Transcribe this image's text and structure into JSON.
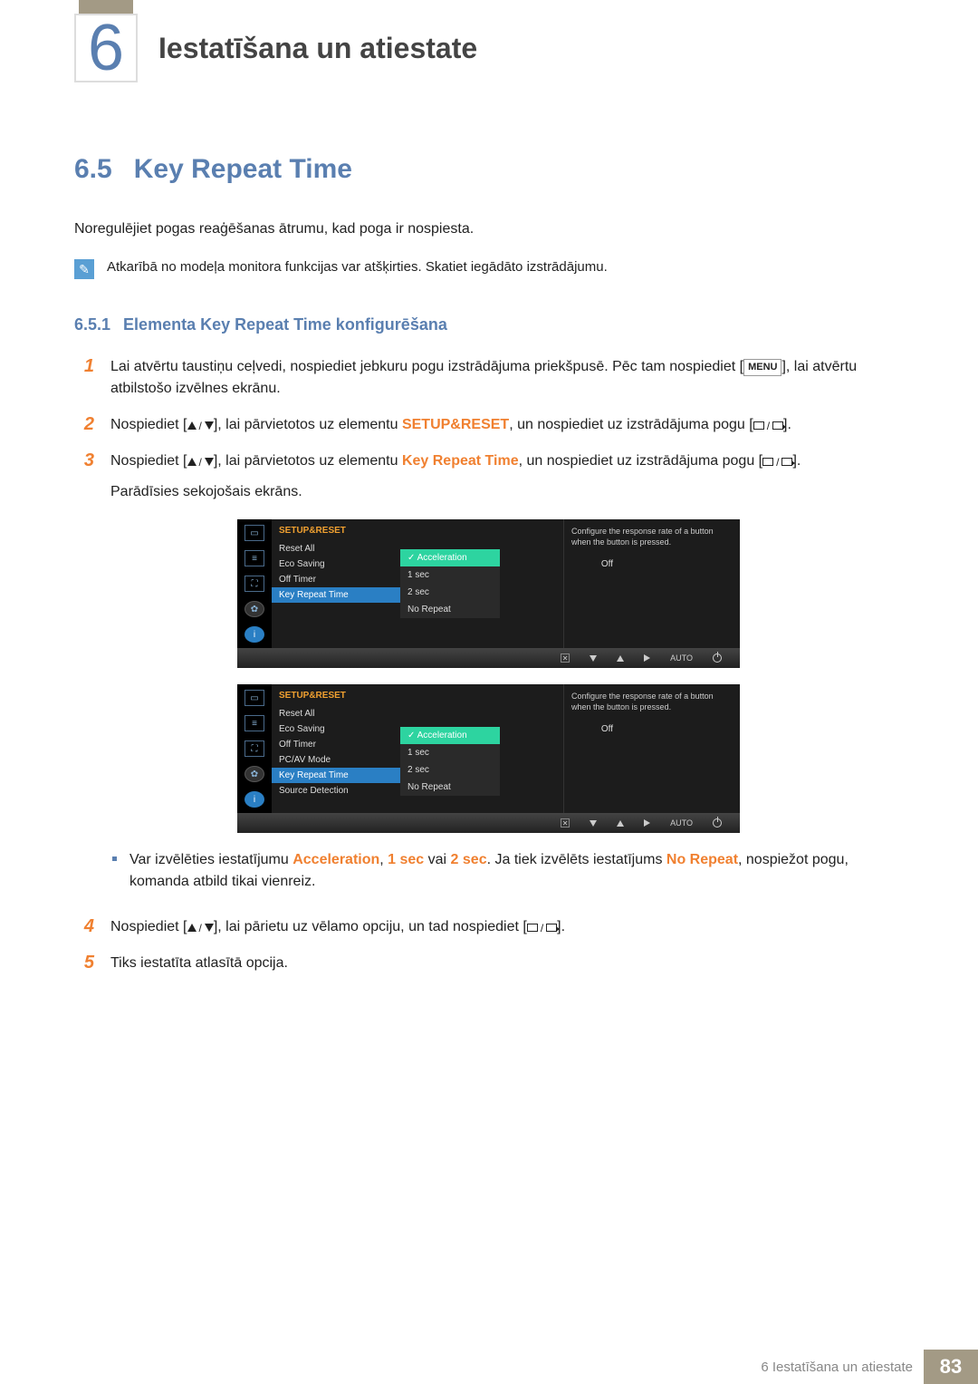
{
  "header": {
    "chapter_number": "6",
    "chapter_title": "Iestatīšana un atiestate"
  },
  "section": {
    "number": "6.5",
    "title": "Key Repeat Time",
    "intro": "Noregulējiet pogas reaģēšanas ātrumu, kad poga ir nospiesta.",
    "note": "Atkarībā no modeļa monitora funkcijas var atšķirties. Skatiet iegādāto izstrādājumu."
  },
  "subsection": {
    "number": "6.5.1",
    "title": "Elementa Key Repeat Time konfigurēšana"
  },
  "steps": {
    "s1a": "Lai atvērtu taustiņu ceļvedi, nospiediet jebkuru pogu izstrādājuma priekšpusē. Pēc tam nospiediet [",
    "s1b": "], lai atvērtu atbilstošo izvēlnes ekrānu.",
    "menu_label": "MENU",
    "s2a": "Nospiediet [",
    "s2b": "], lai pārvietotos uz elementu ",
    "s2c": ", un nospiediet uz izstrādājuma pogu [",
    "s2d": "].",
    "setup_reset": "SETUP&RESET",
    "s3a": "Nospiediet [",
    "s3b": "], lai pārvietotos uz elementu ",
    "s3c": ", un nospiediet uz izstrādājuma pogu [",
    "s3d": "].",
    "key_repeat": "Key Repeat Time",
    "s3e": "Parādīsies sekojošais ekrāns.",
    "bullet_a": "Var izvēlēties iestatījumu ",
    "bullet_b": ", ",
    "bullet_c": " vai ",
    "bullet_d": ". Ja tiek izvēlēts iestatījums ",
    "bullet_e": ", nospiežot pogu, komanda atbild tikai vienreiz.",
    "acc": "Acceleration",
    "one_sec": "1 sec",
    "two_sec": "2 sec",
    "no_repeat": "No Repeat",
    "s4a": "Nospiediet [",
    "s4b": "], lai pārietu uz vēlamo opciju, un tad nospiediet [",
    "s4c": "].",
    "s5": "Tiks iestatīta atlasītā opcija."
  },
  "osd1": {
    "title": "SETUP&RESET",
    "items": [
      "Reset All",
      "Eco Saving",
      "Off Timer",
      "Key Repeat Time"
    ],
    "eco_val": "Off",
    "selected_index": 3,
    "dropdown": [
      "Acceleration",
      "1 sec",
      "2 sec",
      "No Repeat"
    ],
    "tooltip": "Configure the response rate of a button when the button is pressed.",
    "nav_auto": "AUTO"
  },
  "osd2": {
    "title": "SETUP&RESET",
    "items": [
      "Reset All",
      "Eco Saving",
      "Off Timer",
      "PC/AV Mode",
      "Key Repeat Time",
      "Source Detection"
    ],
    "eco_val": "Off",
    "selected_index": 4,
    "dropdown": [
      "Acceleration",
      "1 sec",
      "2 sec",
      "No Repeat"
    ],
    "tooltip": "Configure the response rate of a button when the button is pressed.",
    "nav_auto": "AUTO"
  },
  "footer": {
    "chapter_ref": "6 Iestatīšana un atiestate",
    "page": "83"
  }
}
